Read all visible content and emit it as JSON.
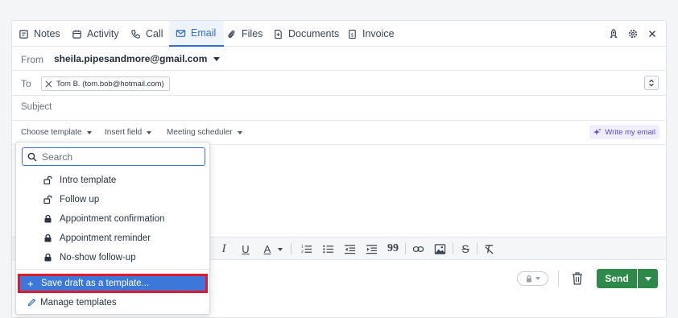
{
  "tabs": [
    {
      "label": "Notes",
      "icon": "notes-icon"
    },
    {
      "label": "Activity",
      "icon": "calendar-icon"
    },
    {
      "label": "Call",
      "icon": "phone-icon"
    },
    {
      "label": "Email",
      "icon": "mail-icon",
      "active": true
    },
    {
      "label": "Files",
      "icon": "paperclip-icon"
    },
    {
      "label": "Documents",
      "icon": "document-icon"
    },
    {
      "label": "Invoice",
      "icon": "invoice-icon"
    }
  ],
  "header_actions": [
    "rocket-icon",
    "gear-icon",
    "close-icon"
  ],
  "compose": {
    "from_label": "From",
    "from_value": "sheila.pipesandmore@gmail.com",
    "to_label": "To",
    "to_chip": "Tom B. (tom.bob@hotmail.com)",
    "subject_label": "Subject"
  },
  "toolbar": {
    "choose_template": "Choose template",
    "insert_field": "Insert field",
    "meeting_scheduler": "Meeting scheduler",
    "write_my_email": "Write my email"
  },
  "template_dropdown": {
    "search_placeholder": "Search",
    "items": [
      {
        "label": "Intro template",
        "icon": "unlock-icon"
      },
      {
        "label": "Follow up",
        "icon": "unlock-icon"
      },
      {
        "label": "Appointment confirmation",
        "icon": "lock-icon"
      },
      {
        "label": "Appointment reminder",
        "icon": "lock-icon"
      },
      {
        "label": "No-show follow-up",
        "icon": "lock-icon"
      }
    ],
    "save_draft": "Save draft as a template...",
    "manage": "Manage templates"
  },
  "send": {
    "label": "Send"
  },
  "colors": {
    "accent": "#2f6fd6",
    "send_green": "#2d8a4b",
    "highlight_border": "#e01a2a",
    "ai_purple": "#5a4bd1"
  }
}
